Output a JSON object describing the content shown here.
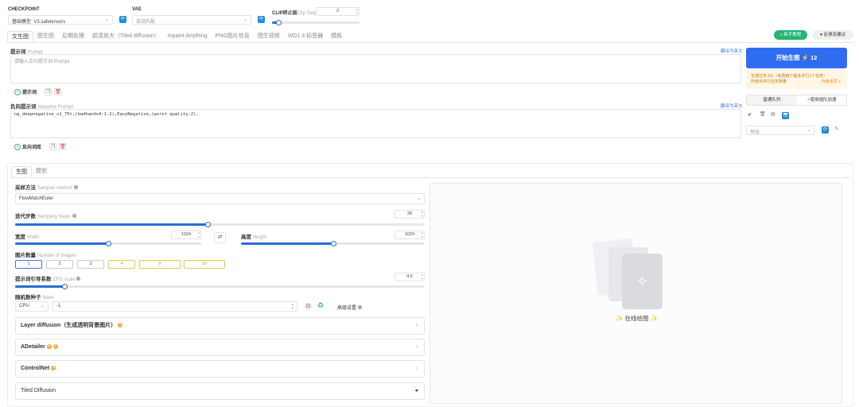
{
  "top": {
    "checkpoint_label": "CHECKPOINT",
    "checkpoint_value": "基础模型_V3.safetensors",
    "vae_label": "VAE",
    "vae_value": "自动匹配",
    "clip_label": "CLIP终止层",
    "clip_sub": "Clip Skip",
    "clip_value": "2"
  },
  "tabs": [
    "文生图",
    "图生图",
    "后期处理",
    "超清放大（Tiled diffusion）",
    "Inpaint Anything",
    "PNG图片信息",
    "图生视频",
    "WD1.4 标签器",
    "模板"
  ],
  "right_buttons": {
    "new_guide": "新手教程",
    "feedback": "反馈及建议"
  },
  "prompt": {
    "label": "提示词",
    "sub": "Prompt",
    "translate": "翻译为英文",
    "placeholder": "请输入正向提示词 Prompt",
    "tool_label": "提示词"
  },
  "negative": {
    "label": "负向提示词",
    "sub": "Negative Prompt",
    "translate": "翻译为英文",
    "value": "ng_deepnegative_v1_75t,(badhandv4:1.2),EasyNegative,(worst quality:2),",
    "tool_label": "反向词库"
  },
  "generate": {
    "button": "开始生图",
    "count": "12",
    "task_info": "生成任务 0/1（免费用户最多并行1个任务）",
    "task_link": "升级可并行任务数量",
    "task_upgrade": "升级会员 >",
    "queue_normal": "普通队列",
    "queue_fast": "使用插队加速",
    "select_placeholder": "预设"
  },
  "subtabs": [
    "生图",
    "模型"
  ],
  "sampler": {
    "label": "采样方法",
    "sub": "Sampler method",
    "value": "FlowMatchEuler"
  },
  "steps": {
    "label": "迭代步数",
    "sub": "Sampling Steps",
    "value": "28",
    "fraction": 0.47
  },
  "width": {
    "label": "宽度",
    "sub": "Width",
    "value": "1024",
    "fraction": 0.5
  },
  "height": {
    "label": "高度",
    "sub": "Height",
    "value": "1024",
    "fraction": 0.5
  },
  "batch": {
    "label": "图片数量",
    "sub": "Number of images",
    "options": [
      "1",
      "2",
      "3",
      "4",
      "8",
      "16"
    ]
  },
  "cfg": {
    "label": "提示词引导系数",
    "sub": "CFG scale",
    "value": "4.5",
    "fraction": 0.12
  },
  "seed": {
    "label": "随机数种子",
    "sub": "Seed",
    "device": "CPU",
    "value": "-1",
    "advanced": "高级设置"
  },
  "accordions": [
    "Layer diffusion（生成透明背景图片）",
    "ADetailer",
    "ControlNet",
    "Tiled Diffusion"
  ],
  "canvas": {
    "caption": "在线绘图"
  },
  "colors": {
    "accent": "#2b6cd8",
    "generate": "#2f6df0",
    "green": "#22b573"
  }
}
